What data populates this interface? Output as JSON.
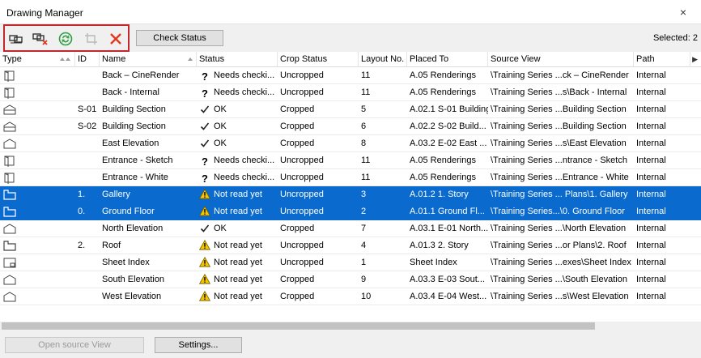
{
  "window": {
    "title": "Drawing Manager",
    "close_glyph": "×"
  },
  "toolbar": {
    "icons": [
      "link-drawing-icon",
      "unlink-drawing-icon",
      "update-icon",
      "crop-icon",
      "delete-icon"
    ],
    "check_status_label": "Check Status",
    "selected_label": "Selected: 2"
  },
  "columns": [
    "Type",
    "ID",
    "Name",
    "Status",
    "Crop Status",
    "Layout No.",
    "Placed To",
    "Source View",
    "Path"
  ],
  "rows": [
    {
      "type": "interior-elevation",
      "id": "",
      "name": "Back – CineRender",
      "status": "Needs checki...",
      "status_kind": "question",
      "crop": "Uncropped",
      "layout_no": "11",
      "placed_to": "A.05 Renderings",
      "source_view": "\\Training Series ...ck – CineRender",
      "path": "Internal",
      "selected": false
    },
    {
      "type": "interior-elevation",
      "id": "",
      "name": "Back - Internal",
      "status": "Needs checki...",
      "status_kind": "question",
      "crop": "Uncropped",
      "layout_no": "11",
      "placed_to": "A.05 Renderings",
      "source_view": "\\Training Series ...s\\Back - Internal",
      "path": "Internal",
      "selected": false
    },
    {
      "type": "section",
      "id": "S-01",
      "name": "Building Section",
      "status": "OK",
      "status_kind": "ok",
      "crop": "Cropped",
      "layout_no": "5",
      "placed_to": "A.02.1 S-01 Building Se...",
      "source_view": "\\Training Series ...Building Section",
      "path": "Internal",
      "selected": false
    },
    {
      "type": "section",
      "id": "S-02",
      "name": "Building Section",
      "status": "OK",
      "status_kind": "ok",
      "crop": "Cropped",
      "layout_no": "6",
      "placed_to": "A.02.2 S-02 Build...",
      "source_view": "\\Training Series ...Building Section",
      "path": "Internal",
      "selected": false
    },
    {
      "type": "elevation",
      "id": "",
      "name": "East Elevation",
      "status": "OK",
      "status_kind": "ok",
      "crop": "Cropped",
      "layout_no": "8",
      "placed_to": "A.03.2 E-02 East ...",
      "source_view": "\\Training Series ...s\\East Elevation",
      "path": "Internal",
      "selected": false
    },
    {
      "type": "interior-elevation",
      "id": "",
      "name": "Entrance - Sketch",
      "status": "Needs checki...",
      "status_kind": "question",
      "crop": "Uncropped",
      "layout_no": "11",
      "placed_to": "A.05 Renderings",
      "source_view": "\\Training Series ...ntrance - Sketch",
      "path": "Internal",
      "selected": false
    },
    {
      "type": "interior-elevation",
      "id": "",
      "name": "Entrance - White",
      "status": "Needs checki...",
      "status_kind": "question",
      "crop": "Uncropped",
      "layout_no": "11",
      "placed_to": "A.05 Renderings",
      "source_view": "\\Training Series ...Entrance - White",
      "path": "Internal",
      "selected": false
    },
    {
      "type": "floor-plan",
      "id": "1.",
      "name": "Gallery",
      "status": "Not read yet",
      "status_kind": "warning",
      "crop": "Uncropped",
      "layout_no": "3",
      "placed_to": "A.01.2 1. Story",
      "source_view": "\\Training Series ... Plans\\1. Gallery",
      "path": "Internal",
      "selected": true
    },
    {
      "type": "floor-plan",
      "id": "0.",
      "name": "Ground Floor",
      "status": "Not read yet",
      "status_kind": "warning",
      "crop": "Uncropped",
      "layout_no": "2",
      "placed_to": "A.01.1 Ground Fl...",
      "source_view": "\\Training Series...\\0. Ground Floor",
      "path": "Internal",
      "selected": true
    },
    {
      "type": "elevation",
      "id": "",
      "name": "North Elevation",
      "status": "OK",
      "status_kind": "ok",
      "crop": "Cropped",
      "layout_no": "7",
      "placed_to": "A.03.1 E-01 North...",
      "source_view": "\\Training Series ...\\North Elevation",
      "path": "Internal",
      "selected": false
    },
    {
      "type": "floor-plan",
      "id": "2.",
      "name": "Roof",
      "status": "Not read yet",
      "status_kind": "warning",
      "crop": "Uncropped",
      "layout_no": "4",
      "placed_to": "A.01.3 2. Story",
      "source_view": "\\Training Series ...or Plans\\2. Roof",
      "path": "Internal",
      "selected": false
    },
    {
      "type": "sheet-index",
      "id": "",
      "name": "Sheet Index",
      "status": "Not read yet",
      "status_kind": "warning",
      "crop": "Uncropped",
      "layout_no": "1",
      "placed_to": "Sheet Index",
      "source_view": "\\Training Series ...exes\\Sheet Index",
      "path": "Internal",
      "selected": false
    },
    {
      "type": "elevation",
      "id": "",
      "name": "South Elevation",
      "status": "Not read yet",
      "status_kind": "warning",
      "crop": "Cropped",
      "layout_no": "9",
      "placed_to": "A.03.3 E-03 Sout...",
      "source_view": "\\Training Series ...\\South Elevation",
      "path": "Internal",
      "selected": false
    },
    {
      "type": "elevation",
      "id": "",
      "name": "West Elevation",
      "status": "Not read yet",
      "status_kind": "warning",
      "crop": "Cropped",
      "layout_no": "10",
      "placed_to": "A.03.4 E-04 West...",
      "source_view": "\\Training Series ...s\\West Elevation",
      "path": "Internal",
      "selected": false
    }
  ],
  "footer": {
    "open_source_view_label": "Open source View",
    "settings_label": "Settings..."
  },
  "colors": {
    "selection": "#0a6acd",
    "highlight_border": "#c0282d",
    "update_icon": "#2e9e3e",
    "delete_icon": "#e03a1e",
    "warning": "#f5c400"
  }
}
